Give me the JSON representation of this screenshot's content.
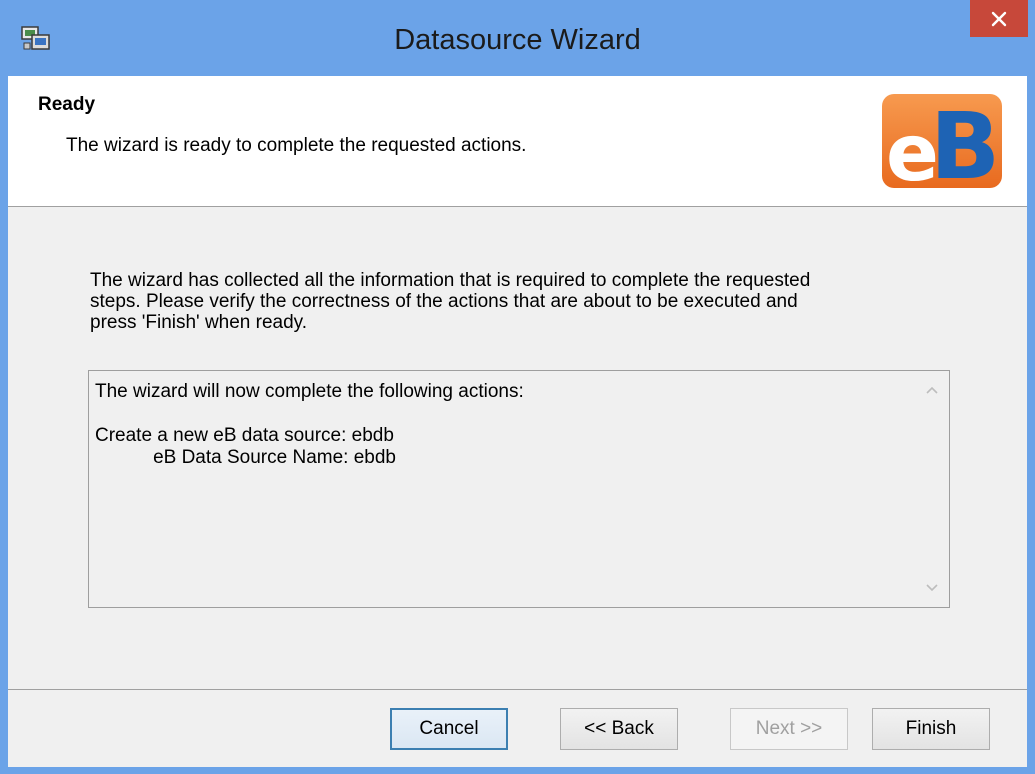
{
  "window": {
    "title": "Datasource Wizard",
    "icon": "wizard-app-icon",
    "close_icon": "close-icon",
    "titlebar_color": "#6ba3e8",
    "close_color": "#c7483a"
  },
  "header": {
    "title": "Ready",
    "subtitle": "The wizard is ready to complete the requested actions.",
    "logo_text": "eB",
    "logo_colors": {
      "e": "#f07a2a",
      "B": "#1e63b4"
    }
  },
  "main": {
    "intro": "The wizard has collected all the information that is required to complete the requested\nsteps. Please verify the correctness of the actions that are about to be executed and\npress 'Finish' when ready.",
    "actions": {
      "text": "The wizard will now complete the following actions:\n\nCreate a new eB data source: ebdb\n           eB Data Source Name: ebdb",
      "scroll_up_icon": "chevron-up-icon",
      "scroll_down_icon": "chevron-down-icon"
    }
  },
  "footer": {
    "cancel_label": "Cancel",
    "back_label": "<< Back",
    "next_label": "Next >>",
    "finish_label": "Finish"
  }
}
